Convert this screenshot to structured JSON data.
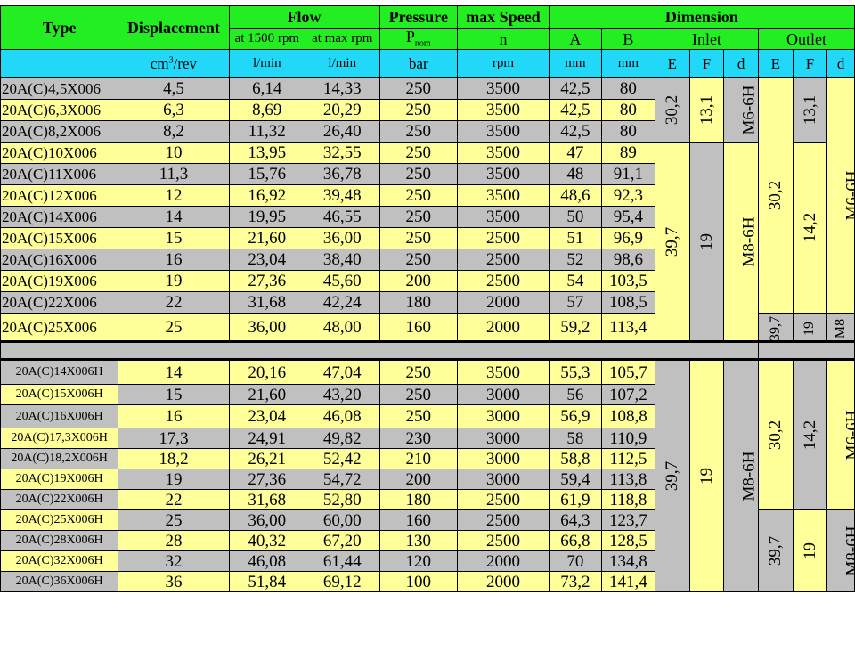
{
  "headers": {
    "type": "Type",
    "displacement": "Displacement",
    "flow": "Flow",
    "pressure": "Pressure",
    "max_speed": "max Speed",
    "dimension": "Dimension",
    "flow_1500": "at 1500 rpm",
    "flow_max": "at max rpm",
    "p_nom_base": "P",
    "p_nom_sub": "nom",
    "speed_n": "n",
    "col_a": "A",
    "col_b": "B",
    "inlet": "Inlet",
    "outlet": "Outlet"
  },
  "units": {
    "disp_base": "cm",
    "disp_sup": "3",
    "disp_rest": "/rev",
    "flow1": "l/min",
    "flow2": "l/min",
    "pressure": "bar",
    "speed": "rpm",
    "a": "mm",
    "b": "mm",
    "in_e": "E",
    "in_f": "F",
    "in_d": "d",
    "out_e": "E",
    "out_f": "F",
    "out_d": "d"
  },
  "rows1": [
    {
      "type": "20A(C)4,5X006",
      "disp": "4,5",
      "f1": "6,14",
      "f2": "14,33",
      "p": "250",
      "n": "3500",
      "a": "42,5",
      "b": "80"
    },
    {
      "type": "20A(C)6,3X006",
      "disp": "6,3",
      "f1": "8,69",
      "f2": "20,29",
      "p": "250",
      "n": "3500",
      "a": "42,5",
      "b": "80"
    },
    {
      "type": "20A(C)8,2X006",
      "disp": "8,2",
      "f1": "11,32",
      "f2": "26,40",
      "p": "250",
      "n": "3500",
      "a": "42,5",
      "b": "80"
    },
    {
      "type": "20A(C)10X006",
      "disp": "10",
      "f1": "13,95",
      "f2": "32,55",
      "p": "250",
      "n": "3500",
      "a": "47",
      "b": "89"
    },
    {
      "type": "20A(C)11X006",
      "disp": "11,3",
      "f1": "15,76",
      "f2": "36,78",
      "p": "250",
      "n": "3500",
      "a": "48",
      "b": "91,1"
    },
    {
      "type": "20A(C)12X006",
      "disp": "12",
      "f1": "16,92",
      "f2": "39,48",
      "p": "250",
      "n": "3500",
      "a": "48,6",
      "b": "92,3"
    },
    {
      "type": "20A(C)14X006",
      "disp": "14",
      "f1": "19,95",
      "f2": "46,55",
      "p": "250",
      "n": "3500",
      "a": "50",
      "b": "95,4"
    },
    {
      "type": "20A(C)15X006",
      "disp": "15",
      "f1": "21,60",
      "f2": "36,00",
      "p": "250",
      "n": "2500",
      "a": "51",
      "b": "96,9"
    },
    {
      "type": "20A(C)16X006",
      "disp": "16",
      "f1": "23,04",
      "f2": "38,40",
      "p": "250",
      "n": "2500",
      "a": "52",
      "b": "98,6"
    },
    {
      "type": "20A(C)19X006",
      "disp": "19",
      "f1": "27,36",
      "f2": "45,60",
      "p": "200",
      "n": "2500",
      "a": "54",
      "b": "103,5"
    },
    {
      "type": "20A(C)22X006",
      "disp": "22",
      "f1": "31,68",
      "f2": "42,24",
      "p": "180",
      "n": "2000",
      "a": "57",
      "b": "108,5"
    },
    {
      "type": "20A(C)25X006",
      "disp": "25",
      "f1": "36,00",
      "f2": "48,00",
      "p": "160",
      "n": "2000",
      "a": "59,2",
      "b": "113,4"
    }
  ],
  "rows2": [
    {
      "type": "20A(C)14X006H",
      "disp": "14",
      "f1": "20,16",
      "f2": "47,04",
      "p": "250",
      "n": "3500",
      "a": "55,3",
      "b": "105,7"
    },
    {
      "type": "20A(C)15X006H",
      "disp": "15",
      "f1": "21,60",
      "f2": "43,20",
      "p": "250",
      "n": "3000",
      "a": "56",
      "b": "107,2"
    },
    {
      "type": "20A(C)16X006H",
      "disp": "16",
      "f1": "23,04",
      "f2": "46,08",
      "p": "250",
      "n": "3000",
      "a": "56,9",
      "b": "108,8"
    },
    {
      "type": "20A(C)17,3X006H",
      "disp": "17,3",
      "f1": "24,91",
      "f2": "49,82",
      "p": "230",
      "n": "3000",
      "a": "58",
      "b": "110,9"
    },
    {
      "type": "20A(C)18,2X006H",
      "disp": "18,2",
      "f1": "26,21",
      "f2": "52,42",
      "p": "210",
      "n": "3000",
      "a": "58,8",
      "b": "112,5"
    },
    {
      "type": "20A(C)19X006H",
      "disp": "19",
      "f1": "27,36",
      "f2": "54,72",
      "p": "200",
      "n": "3000",
      "a": "59,4",
      "b": "113,8"
    },
    {
      "type": "20A(C)22X006H",
      "disp": "22",
      "f1": "31,68",
      "f2": "52,80",
      "p": "180",
      "n": "2500",
      "a": "61,9",
      "b": "118,8"
    },
    {
      "type": "20A(C)25X006H",
      "disp": "25",
      "f1": "36,00",
      "f2": "60,00",
      "p": "160",
      "n": "2500",
      "a": "64,3",
      "b": "123,7"
    },
    {
      "type": "20A(C)28X006H",
      "disp": "28",
      "f1": "40,32",
      "f2": "67,20",
      "p": "130",
      "n": "2500",
      "a": "66,8",
      "b": "128,5"
    },
    {
      "type": "20A(C)32X006H",
      "disp": "32",
      "f1": "46,08",
      "f2": "61,44",
      "p": "120",
      "n": "2000",
      "a": "70",
      "b": "134,8"
    },
    {
      "type": "20A(C)36X006H",
      "disp": "36",
      "f1": "51,84",
      "f2": "69,12",
      "p": "100",
      "n": "2000",
      "a": "73,2",
      "b": "141,4"
    }
  ],
  "dims1": {
    "in_e_a": "30,2",
    "in_f_a": "13,1",
    "in_d_a": "M6-6H",
    "in_e_b": "39,7",
    "in_f_b": "19",
    "in_d_b": "M8-6H",
    "out_e_a": "30,2",
    "out_f_a": "13,1",
    "out_f_b": "14,2",
    "out_d_a": "M6-6H",
    "out_e_c": "39,7",
    "out_f_c": "19",
    "out_d_c": "M8"
  },
  "dims2": {
    "in_e": "39,7",
    "in_f": "19",
    "in_d": "M8-6H",
    "out_e_a": "30,2",
    "out_f_a": "14,2",
    "out_d_a": "M6-6H",
    "out_e_b": "39,7",
    "out_f_b": "19",
    "out_d_b": "M8-6H"
  },
  "colors": {
    "header_green": "#22ee22",
    "units_cyan": "#22d8f8",
    "row_gray": "#c0c0c0",
    "row_yellow": "#ffff99"
  }
}
